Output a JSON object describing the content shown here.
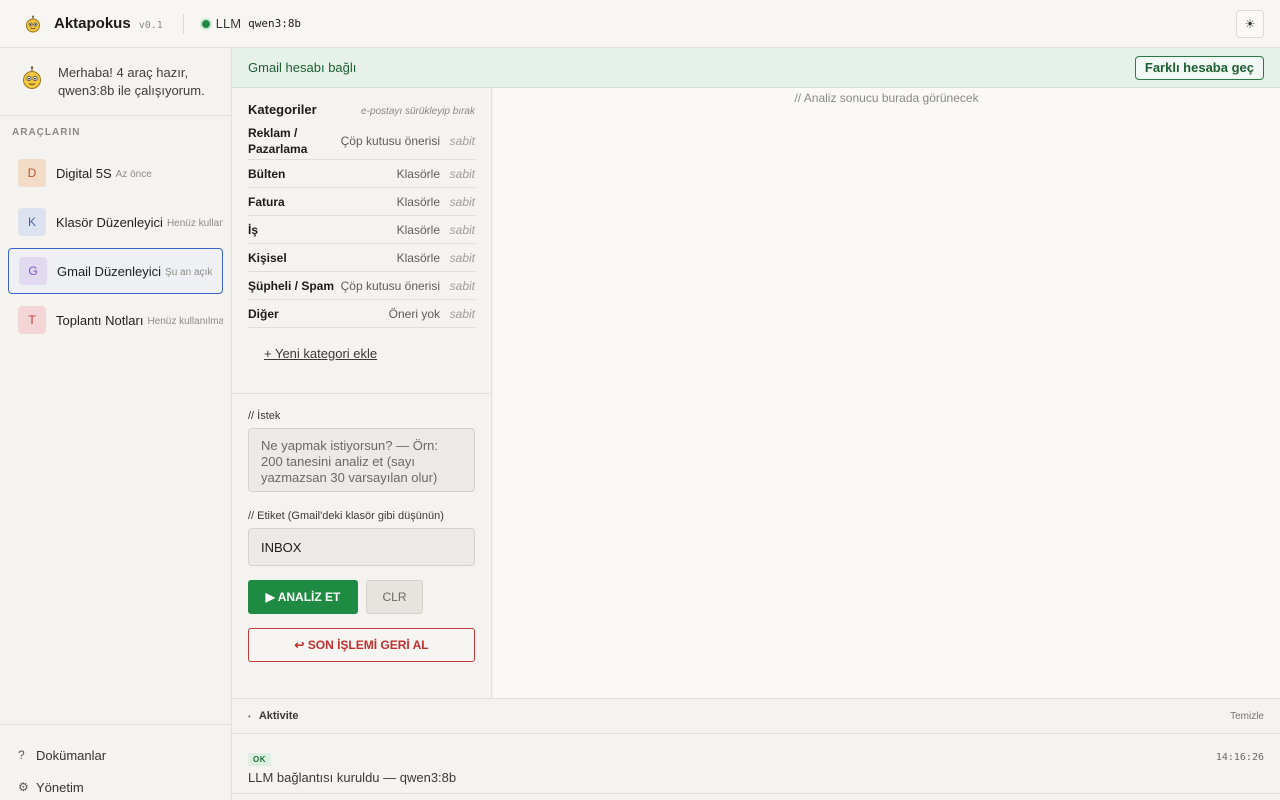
{
  "header": {
    "title": "Aktapokus",
    "version": "v0.1",
    "llm_label": "LLM",
    "llm_model": "qwen3:8b",
    "theme_icon": "sun-icon",
    "theme_glyph": "☀"
  },
  "sidebar": {
    "greeting": "Merhaba! 4 araç hazır, qwen3:8b ile çalışıyorum.",
    "section_title": "ARAÇLARIN",
    "tools": [
      {
        "letter": "D",
        "name": "Digital 5S",
        "status": "Az önce",
        "badge_bg": "#f2dcc8",
        "badge_fg": "#b4572b",
        "active": false
      },
      {
        "letter": "K",
        "name": "Klasör Düzenleyici",
        "status": "Henüz kullanılmadı",
        "badge_bg": "#dde3ee",
        "badge_fg": "#4565a8",
        "active": false
      },
      {
        "letter": "G",
        "name": "Gmail Düzenleyici",
        "status": "Şu an açık",
        "badge_bg": "#e2daf0",
        "badge_fg": "#7a55c0",
        "active": true
      },
      {
        "letter": "T",
        "name": "Toplantı Notları",
        "status": "Henüz kullanılmadı",
        "badge_bg": "#f3d5d5",
        "badge_fg": "#c03a3a",
        "active": false
      }
    ],
    "footer": {
      "docs_icon": "?",
      "docs": "Dokümanlar",
      "admin_icon": "⚙",
      "admin": "Yönetim"
    }
  },
  "banner": {
    "text": "Gmail hesabı bağlı",
    "switch_label": "Farklı hesaba geç"
  },
  "categories": {
    "title": "Kategoriler",
    "hint": "e-postayı sürükleyip bırak",
    "rows": [
      {
        "name": "Reklam / Pazarlama",
        "action": "Çöp kutusu önerisi",
        "fixed": "sabit"
      },
      {
        "name": "Bülten",
        "action": "Klasörle",
        "fixed": "sabit"
      },
      {
        "name": "Fatura",
        "action": "Klasörle",
        "fixed": "sabit"
      },
      {
        "name": "İş",
        "action": "Klasörle",
        "fixed": "sabit"
      },
      {
        "name": "Kişisel",
        "action": "Klasörle",
        "fixed": "sabit"
      },
      {
        "name": "Şüpheli / Spam",
        "action": "Çöp kutusu önerisi",
        "fixed": "sabit"
      },
      {
        "name": "Diğer",
        "action": "Öneri yok",
        "fixed": "sabit"
      }
    ],
    "add_label": "+ Yeni kategori ekle"
  },
  "request": {
    "label": "// İstek",
    "placeholder": "Ne yapmak istiyorsun?  —  Örn: 200 tanesini analiz et (sayı yazmazsan 30 varsayılan olur)",
    "tag_label": "// Etiket (Gmail'deki klasör gibi düşünün)",
    "tag_value": "INBOX",
    "analyze_label": "▶ ANALİZ ET",
    "clr_label": "CLR",
    "undo_label": "↩ SON İŞLEMİ GERİ AL"
  },
  "result": {
    "placeholder": "// Analiz sonucu burada görünecek"
  },
  "activity": {
    "title": "Aktivite",
    "clear_label": "Temizle",
    "log": {
      "badge": "OK",
      "time": "14:16:26",
      "message": "LLM bağlantısı kuruldu — qwen3:8b"
    }
  }
}
